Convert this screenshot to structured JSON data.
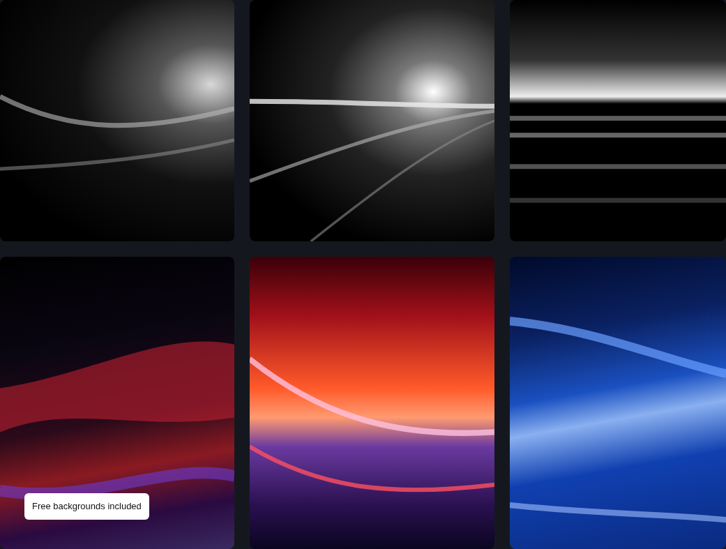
{
  "badge": {
    "label": "Free backgrounds included"
  }
}
